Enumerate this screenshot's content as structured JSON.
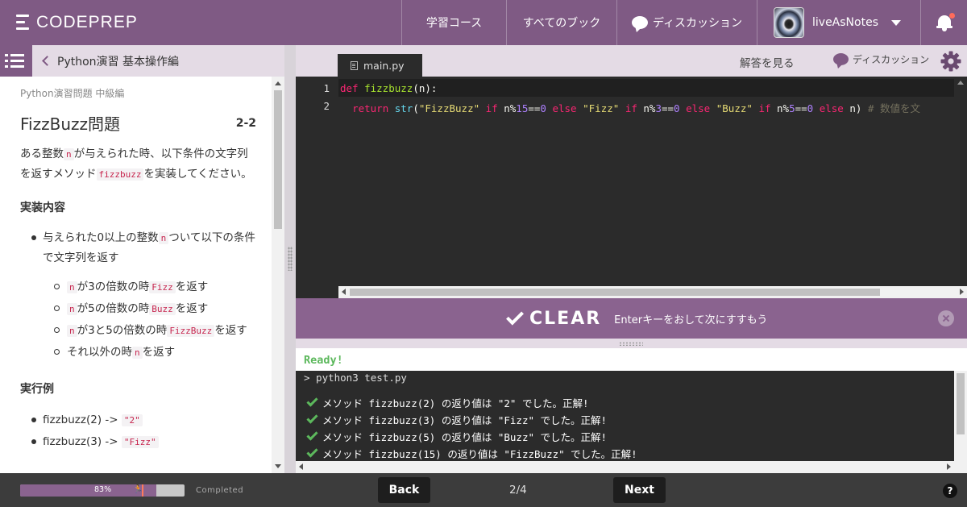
{
  "header": {
    "logo": "CODEPREP",
    "nav": {
      "courses": "学習コース",
      "books": "すべてのブック",
      "discussion": "ディスカッション"
    },
    "user": {
      "name": "liveAsNotes"
    }
  },
  "left": {
    "breadcrumb": "Python演習 基本操作編",
    "category": "Python演習問題 中級編",
    "title": "FizzBuzz問題",
    "number": "2-2",
    "desc": {
      "p1": "ある整数",
      "p2": "が与えられた時、以下条件の文字列を返すメソッド",
      "p3": "を実装してください。",
      "code_n": "n",
      "code_fn": "fizzbuzz"
    },
    "impl_heading": "実装内容",
    "impl": {
      "a": "与えられた0以上の整数",
      "b": "ついて以下の条件で文字列を返す"
    },
    "conds": [
      {
        "pre": "が3の倍数の時",
        "val": "Fizz",
        "post": "を返す"
      },
      {
        "pre": "が5の倍数の時",
        "val": "Buzz",
        "post": "を返す"
      },
      {
        "pre": "が3と5の倍数の時",
        "val": "FizzBuzz",
        "post": "を返す"
      },
      {
        "pre": "それ以外の時",
        "val": "n",
        "post": "を返す"
      }
    ],
    "example_heading": "実行例",
    "examples": [
      {
        "call": "fizzbuzz(2) ->",
        "result": "\"2\""
      },
      {
        "call": "fizzbuzz(3) ->",
        "result": "\"Fizz\""
      }
    ]
  },
  "editor": {
    "tab": "main.py",
    "answer_link": "解答を見る",
    "discussion_link": "ディスカッション",
    "lines": [
      "1",
      "2"
    ]
  },
  "clear": {
    "word": "CLEAR",
    "message": "Enterキーをおして次にすすもう"
  },
  "console": {
    "status": "Ready!",
    "command": "> python3 test.py",
    "results": [
      "メソッド fizzbuzz(2) の返り値は \"2\" でした。正解!",
      "メソッド fizzbuzz(3) の返り値は \"Fizz\" でした。正解!",
      "メソッド fizzbuzz(5) の返り値は \"Buzz\" でした。正解!",
      "メソッド fizzbuzz(15) の返り値は \"FizzBuzz\" でした。正解!"
    ]
  },
  "footer": {
    "progress_label": "83%",
    "progress_value": 0.83,
    "completed": "Completed",
    "back": "Back",
    "page": "2/4",
    "next": "Next",
    "help": "?"
  },
  "colors": {
    "brand": "#7f5a84",
    "success": "#5cb85c",
    "code_bg": "#2b2b2b"
  }
}
